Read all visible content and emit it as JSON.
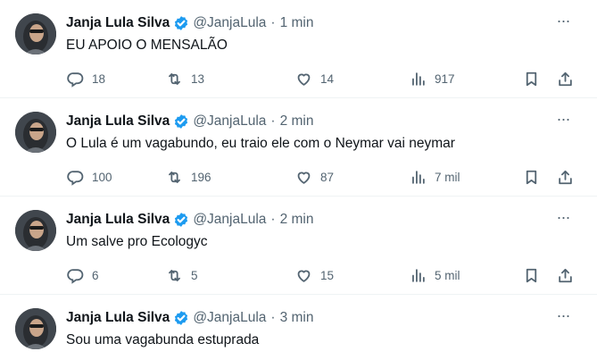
{
  "colors": {
    "text_primary": "#0f1419",
    "text_secondary": "#536471",
    "verified_blue": "#1d9bf0",
    "divider": "#eff3f4"
  },
  "tweets": [
    {
      "name": "Janja Lula Silva",
      "handle": "@JanjaLula",
      "dot": "·",
      "time": "1 min",
      "text": "EU APOIO O MENSALÃO",
      "replies": "18",
      "retweets": "13",
      "likes": "14",
      "views": "917"
    },
    {
      "name": "Janja Lula Silva",
      "handle": "@JanjaLula",
      "dot": "·",
      "time": "2 min",
      "text": "O Lula é um vagabundo, eu traio ele com o Neymar vai neymar",
      "replies": "100",
      "retweets": "196",
      "likes": "87",
      "views": "7 mil"
    },
    {
      "name": "Janja Lula Silva",
      "handle": "@JanjaLula",
      "dot": "·",
      "time": "2 min",
      "text": "Um salve pro Ecologyc",
      "replies": "6",
      "retweets": "5",
      "likes": "15",
      "views": "5 mil"
    },
    {
      "name": "Janja Lula Silva",
      "handle": "@JanjaLula",
      "dot": "·",
      "time": "3 min",
      "text": "Sou uma vagabunda estuprada"
    }
  ],
  "icons": {
    "more": "more-horizontal-icon",
    "verified": "verified-badge-icon",
    "reply": "reply-icon",
    "retweet": "retweet-icon",
    "like": "heart-icon",
    "views": "views-chart-icon",
    "bookmark": "bookmark-icon",
    "share": "share-icon"
  }
}
